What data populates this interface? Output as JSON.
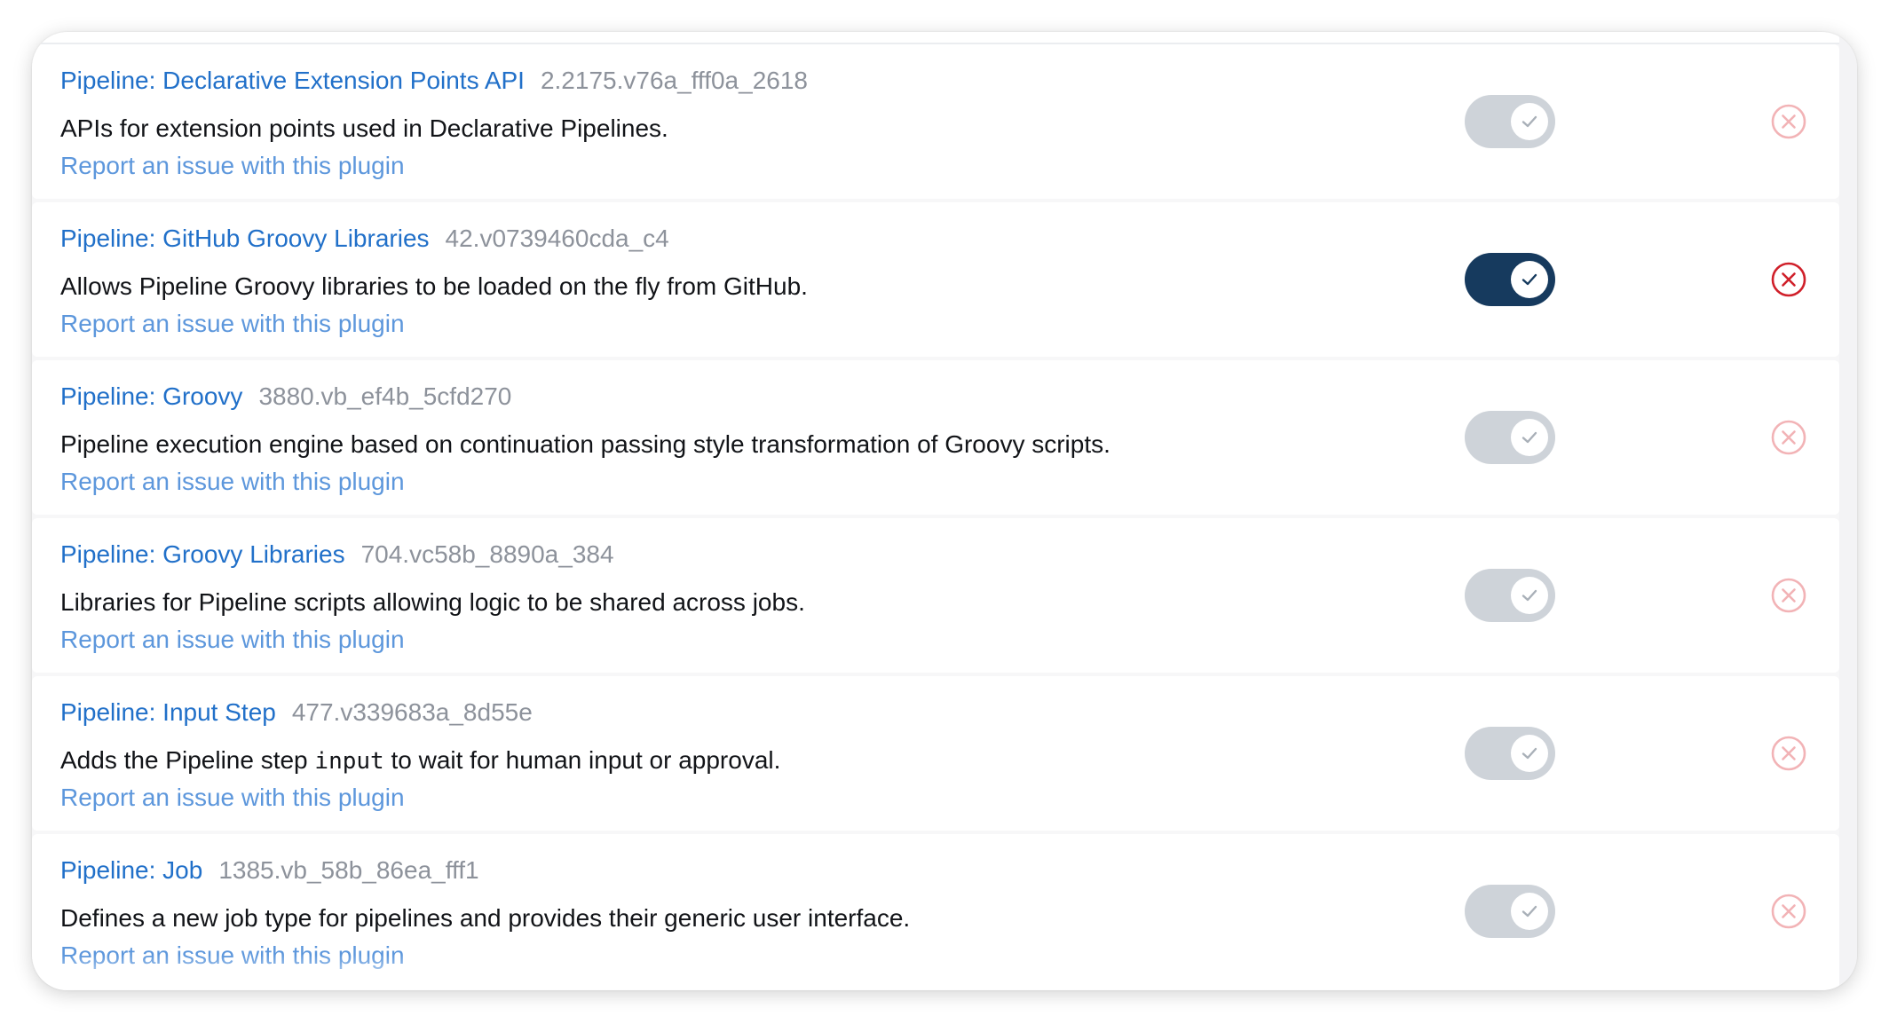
{
  "plugins": [
    {
      "name": "Pipeline: Declarative Extension Points API",
      "version": "2.2175.v76a_fff0a_2618",
      "description": "APIs for extension points used in Declarative Pipelines.",
      "report_link": "Report an issue with this plugin",
      "enabled": false,
      "uninstall_active": false
    },
    {
      "name": "Pipeline: GitHub Groovy Libraries",
      "version": "42.v0739460cda_c4",
      "description": "Allows Pipeline Groovy libraries to be loaded on the fly from GitHub.",
      "report_link": "Report an issue with this plugin",
      "enabled": true,
      "uninstall_active": true
    },
    {
      "name": "Pipeline: Groovy",
      "version": "3880.vb_ef4b_5cfd270",
      "description": "Pipeline execution engine based on continuation passing style transformation of Groovy scripts.",
      "report_link": "Report an issue with this plugin",
      "enabled": false,
      "uninstall_active": false
    },
    {
      "name": "Pipeline: Groovy Libraries",
      "version": "704.vc58b_8890a_384",
      "description": "Libraries for Pipeline scripts allowing logic to be shared across jobs.",
      "report_link": "Report an issue with this plugin",
      "enabled": false,
      "uninstall_active": false
    },
    {
      "name": "Pipeline: Input Step",
      "version": "477.v339683a_8d55e",
      "description_before": "Adds the Pipeline step ",
      "description_code": "input",
      "description_after": " to wait for human input or approval.",
      "report_link": "Report an issue with this plugin",
      "enabled": false,
      "uninstall_active": false
    },
    {
      "name": "Pipeline: Job",
      "version": "1385.vb_58b_86ea_fff1",
      "description": "Defines a new job type for pipelines and provides their generic user interface.",
      "report_link": "Report an issue with this plugin",
      "enabled": false,
      "uninstall_active": false
    }
  ],
  "icons": {
    "toggle_check": "check-icon",
    "uninstall": "circle-x-icon"
  },
  "colors": {
    "link": "#2170c9",
    "link_light": "#5d97dc",
    "version": "#8d929b",
    "toggle_on": "#163a5e",
    "toggle_off": "#ced3d9",
    "uninstall_active": "#d0202a",
    "uninstall_inactive": "#f2b3b6"
  }
}
